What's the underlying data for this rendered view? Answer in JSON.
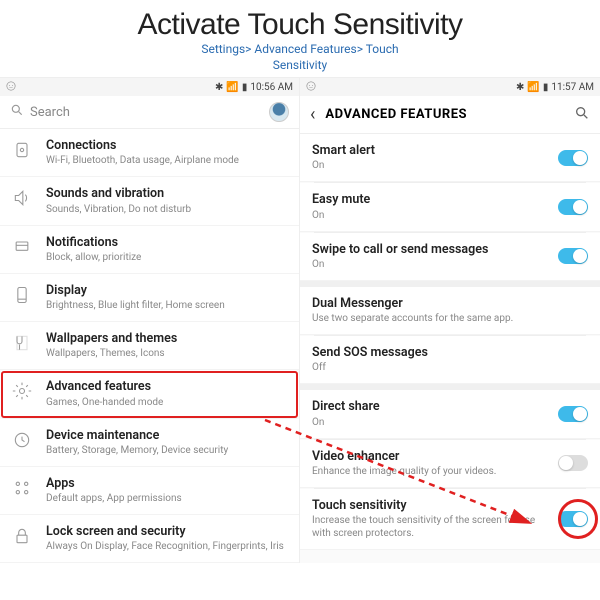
{
  "header": {
    "title": "Activate Touch Sensitivity",
    "path_line1": "Settings> Advanced Features> Touch",
    "path_line2": "Sensitivity"
  },
  "left": {
    "status_time": "10:56 AM",
    "search_placeholder": "Search",
    "rows": [
      {
        "title": "Connections",
        "sub": "Wi-Fi, Bluetooth, Data usage, Airplane mode",
        "icon": "connections"
      },
      {
        "title": "Sounds and vibration",
        "sub": "Sounds, Vibration, Do not disturb",
        "icon": "sound"
      },
      {
        "title": "Notifications",
        "sub": "Block, allow, prioritize",
        "icon": "notifications"
      },
      {
        "title": "Display",
        "sub": "Brightness, Blue light filter, Home screen",
        "icon": "display"
      },
      {
        "title": "Wallpapers and themes",
        "sub": "Wallpapers, Themes, Icons",
        "icon": "wallpaper"
      },
      {
        "title": "Advanced features",
        "sub": "Games, One-handed mode",
        "icon": "advanced",
        "highlight": true
      },
      {
        "title": "Device maintenance",
        "sub": "Battery, Storage, Memory, Device security",
        "icon": "maintenance"
      },
      {
        "title": "Apps",
        "sub": "Default apps, App permissions",
        "icon": "apps"
      },
      {
        "title": "Lock screen and security",
        "sub": "Always On Display, Face Recognition, Fingerprints, Iris",
        "icon": "lock"
      }
    ]
  },
  "right": {
    "status_time": "11:57 AM",
    "header": "ADVANCED FEATURES",
    "rows": [
      {
        "title": "Smart alert",
        "sub": "On",
        "toggle": "on"
      },
      {
        "title": "Easy mute",
        "sub": "On",
        "toggle": "on"
      },
      {
        "title": "Swipe to call or send messages",
        "sub": "On",
        "toggle": "on"
      },
      {
        "title": "Dual Messenger",
        "sub": "Use two separate accounts for the same app."
      },
      {
        "title": "Send SOS messages",
        "sub": "Off"
      },
      {
        "title": "Direct share",
        "sub": "On",
        "toggle": "on"
      },
      {
        "title": "Video enhancer",
        "sub": "Enhance the image quality of your videos.",
        "toggle": "off"
      },
      {
        "title": "Touch sensitivity",
        "sub": "Increase the touch sensitivity of the screen for use with screen protectors.",
        "toggle": "on",
        "circled": true
      }
    ]
  }
}
